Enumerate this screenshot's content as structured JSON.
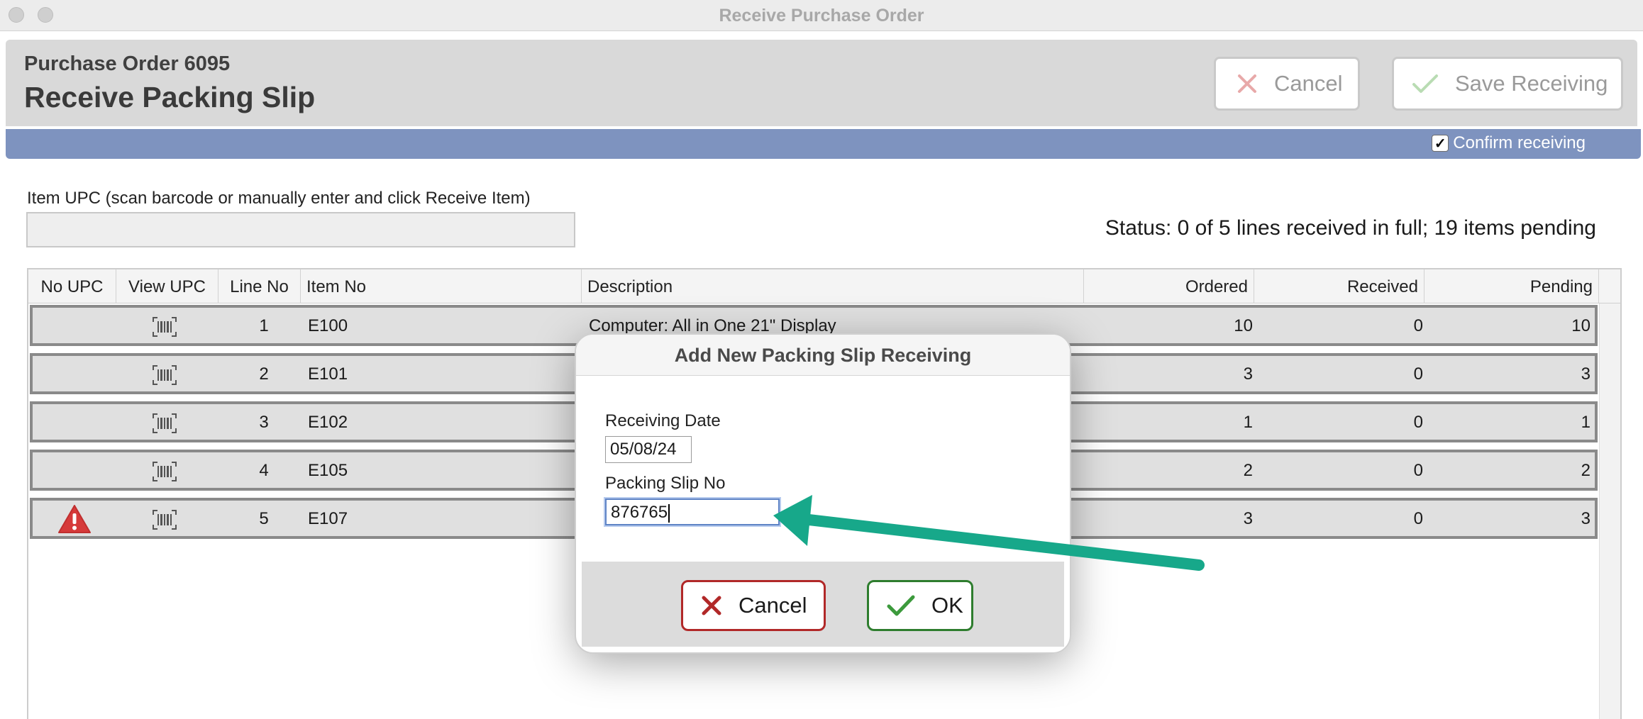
{
  "window": {
    "title": "Receive Purchase Order"
  },
  "header": {
    "po_number": "Purchase Order 6095",
    "page_title": "Receive Packing Slip",
    "cancel_label": "Cancel",
    "save_label": "Save Receiving"
  },
  "bar": {
    "confirm_label": "Confirm receiving",
    "confirm_checked": true
  },
  "upc": {
    "label": "Item UPC (scan barcode or manually enter and click Receive Item)",
    "value": ""
  },
  "status_text": "Status: 0 of 5 lines received in full; 19 items pending",
  "grid": {
    "columns": [
      "No UPC",
      "View UPC",
      "Line No",
      "Item No",
      "Description",
      "Ordered",
      "Received",
      "Pending"
    ],
    "rows": [
      {
        "no_upc_warning": false,
        "line": "1",
        "item": "E100",
        "description": "Computer: All in One 21\" Display",
        "ordered": "10",
        "received": "0",
        "pending": "10"
      },
      {
        "no_upc_warning": false,
        "line": "2",
        "item": "E101",
        "description": "",
        "ordered": "3",
        "received": "0",
        "pending": "3"
      },
      {
        "no_upc_warning": false,
        "line": "3",
        "item": "E102",
        "description": "",
        "ordered": "1",
        "received": "0",
        "pending": "1"
      },
      {
        "no_upc_warning": false,
        "line": "4",
        "item": "E105",
        "description": "",
        "ordered": "2",
        "received": "0",
        "pending": "2"
      },
      {
        "no_upc_warning": true,
        "line": "5",
        "item": "E107",
        "description": "",
        "ordered": "3",
        "received": "0",
        "pending": "3"
      }
    ]
  },
  "dialog": {
    "title": "Add New Packing Slip Receiving",
    "date_label": "Receiving Date",
    "date_value": "05/08/24",
    "slip_label": "Packing Slip No",
    "slip_value": "876765",
    "cancel_label": "Cancel",
    "ok_label": "OK"
  },
  "icons": {
    "cancel": "x-icon",
    "save": "check-icon",
    "view_upc": "barcode-icon",
    "warning": "warning-triangle-icon",
    "callout": "arrow-icon"
  },
  "colors": {
    "accent_bar": "#7e93bf",
    "cancel_red": "#b12828",
    "ok_green": "#2e7d2e",
    "arrow_teal": "#17a88a",
    "warning_red": "#d63a3a"
  }
}
